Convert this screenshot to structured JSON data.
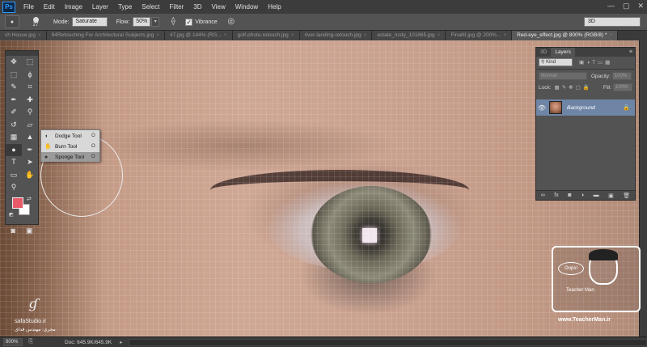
{
  "app": {
    "logo": "Ps"
  },
  "menu": [
    "File",
    "Edit",
    "Image",
    "Layer",
    "Type",
    "Select",
    "Filter",
    "3D",
    "View",
    "Window",
    "Help"
  ],
  "window_controls": {
    "minimize": "—",
    "maximize": "▢",
    "close": "✕"
  },
  "options_bar": {
    "brush_size": "27",
    "mode_label": "Mode:",
    "mode_value": "Saturate",
    "flow_label": "Flow:",
    "flow_value": "50%",
    "vibrance_label": "Vibrance",
    "vibrance_checked": "✓",
    "workspace": "3D"
  },
  "tabs": [
    {
      "label": "ch House.jpg"
    },
    {
      "label": "84Retouching For Architectural Subjects.jpg"
    },
    {
      "label": "47.jpg @ 144% (RG..."
    },
    {
      "label": "golf-photo-retouch.jpg"
    },
    {
      "label": "river-landing-retouch.jpg"
    },
    {
      "label": "estate_rusty_101865.jpg"
    },
    {
      "label": "FinallII.jpg @ 200%..."
    },
    {
      "label": "Red-eye_effect.jpg @ 800% (RGB/8) *"
    }
  ],
  "tools": [
    {
      "name": "move-tool",
      "glyph": "✥"
    },
    {
      "name": "artboard-tool",
      "glyph": "⬚"
    },
    {
      "name": "marquee-tool",
      "glyph": "⬚"
    },
    {
      "name": "lasso-tool",
      "glyph": "ϕ"
    },
    {
      "name": "quick-select-tool",
      "glyph": "✎"
    },
    {
      "name": "crop-tool",
      "glyph": "⌗"
    },
    {
      "name": "eyedropper-tool",
      "glyph": "✒"
    },
    {
      "name": "healing-tool",
      "glyph": "✚"
    },
    {
      "name": "brush-tool",
      "glyph": "✐"
    },
    {
      "name": "clone-stamp-tool",
      "glyph": "⚲"
    },
    {
      "name": "history-brush-tool",
      "glyph": "↺"
    },
    {
      "name": "eraser-tool",
      "glyph": "▱"
    },
    {
      "name": "gradient-tool",
      "glyph": "▦"
    },
    {
      "name": "blur-tool",
      "glyph": "▲"
    },
    {
      "name": "sponge-tool",
      "glyph": "●"
    },
    {
      "name": "pen-tool",
      "glyph": "✒"
    },
    {
      "name": "type-tool",
      "glyph": "T"
    },
    {
      "name": "path-select-tool",
      "glyph": "➤"
    },
    {
      "name": "rectangle-tool",
      "glyph": "▭"
    },
    {
      "name": "hand-tool",
      "glyph": "✋"
    },
    {
      "name": "zoom-tool",
      "glyph": "⚲"
    }
  ],
  "flyout": {
    "items": [
      {
        "label": "Dodge Tool",
        "shortcut": "O",
        "icon": "◖"
      },
      {
        "label": "Burn Tool",
        "shortcut": "O",
        "icon": "✋"
      },
      {
        "label": "Sponge Tool",
        "shortcut": "O",
        "icon": "●"
      }
    ]
  },
  "colors": {
    "foreground": "#e85a6a",
    "background": "#ffffff",
    "layer_selected": "#6f85a6"
  },
  "layers_panel": {
    "tab_3d": "3D",
    "tab_layers": "Layers",
    "kind_label": "Kind",
    "blend_mode": "Normal",
    "opacity_label": "Opacity:",
    "opacity_value": "100%",
    "lock_label": "Lock:",
    "fill_label": "Fill:",
    "fill_value": "100%",
    "layer_name": "Background",
    "footer_icons": [
      "∞",
      "fx",
      "◙",
      "◑",
      "▬",
      "▣",
      "🗑"
    ]
  },
  "watermarks": {
    "left_site": "safaStudio.ir",
    "left_fa": "مجری: مهندس فدای",
    "right_bubble": "Oops!",
    "right_name": "Teacher Man",
    "right_url": "www.TeacherMan.ir"
  },
  "status": {
    "zoom": "800%",
    "doc_info": "Doc: 645.9K/645.9K",
    "arrow": "▸"
  }
}
